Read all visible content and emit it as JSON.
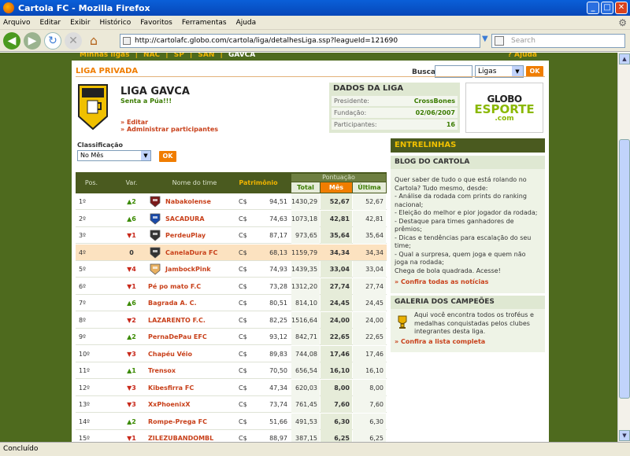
{
  "window": {
    "title": "Cartola FC - Mozilla Firefox"
  },
  "menu": [
    "Arquivo",
    "Editar",
    "Exibir",
    "Histórico",
    "Favoritos",
    "Ferramentas",
    "Ajuda"
  ],
  "browser": {
    "url": "http://cartolafc.globo.com/cartola/liga/detalhesLiga.ssp?leagueId=121690",
    "search_placeholder": "Search",
    "status": "Concluído"
  },
  "top_links": [
    "Minhas ligas",
    "|",
    "NAC",
    "|",
    "SP",
    "|",
    "SAN",
    "|",
    "GAVCA"
  ],
  "help": "? Ajuda",
  "section_title": "LIGA PRIVADA",
  "search": {
    "label": "Busca",
    "select": "Ligas",
    "ok": "OK"
  },
  "liga": {
    "name": "LIGA GAVCA",
    "subtitle": "Senta a Púa!!!",
    "edit_link": "» Editar",
    "admin_link": "» Administrar participantes"
  },
  "dados": {
    "title": "DADOS DA LIGA",
    "rows": [
      {
        "label": "Presidente:",
        "value": "CrossBones"
      },
      {
        "label": "Fundação:",
        "value": "02/06/2007"
      },
      {
        "label": "Participantes:",
        "value": "16"
      }
    ]
  },
  "globo": {
    "line1": "GLOBO",
    "line2": "ESPORTE",
    "line3": ".com"
  },
  "classificacao": {
    "label": "Classificação",
    "selected": "No Mês",
    "ok": "OK"
  },
  "table": {
    "headers": {
      "pos": "Pos.",
      "var": "Var.",
      "team": "Nome do time",
      "pat": "Patrimônio",
      "pont": "Pontuação",
      "total": "Total",
      "mes": "Mês",
      "ult": "Última"
    },
    "rows": [
      {
        "pos": "1º",
        "var": "▲2",
        "dir": "up",
        "team": "Nabakolense",
        "cur": "C$",
        "pat": "94,51",
        "total": "1430,29",
        "mes": "52,67",
        "ult": "52,67",
        "icon": "#7a1a1a"
      },
      {
        "pos": "2º",
        "var": "▲6",
        "dir": "up",
        "team": "SACADURA",
        "cur": "C$",
        "pat": "74,63",
        "total": "1073,18",
        "mes": "42,81",
        "ult": "42,81",
        "icon": "#1a4aa8"
      },
      {
        "pos": "3º",
        "var": "▼1",
        "dir": "down",
        "team": "PerdeuPlay",
        "cur": "C$",
        "pat": "87,17",
        "total": "973,65",
        "mes": "35,64",
        "ult": "35,64",
        "icon": "#333333"
      },
      {
        "pos": "4º",
        "var": "0",
        "dir": "eq",
        "team": "CanelaDura FC",
        "cur": "C$",
        "pat": "68,13",
        "total": "1159,79",
        "mes": "34,34",
        "ult": "34,34",
        "icon": "#333333"
      },
      {
        "pos": "5º",
        "var": "▼4",
        "dir": "down",
        "team": "JambockPink",
        "cur": "C$",
        "pat": "74,93",
        "total": "1439,35",
        "mes": "33,04",
        "ult": "33,04",
        "icon": "#e8b060"
      },
      {
        "pos": "6º",
        "var": "▼1",
        "dir": "down",
        "team": "Pé po mato F.C",
        "cur": "C$",
        "pat": "73,28",
        "total": "1312,20",
        "mes": "27,74",
        "ult": "27,74",
        "icon": ""
      },
      {
        "pos": "7º",
        "var": "▲6",
        "dir": "up",
        "team": "Bagrada A. C.",
        "cur": "C$",
        "pat": "80,51",
        "total": "814,10",
        "mes": "24,45",
        "ult": "24,45",
        "icon": ""
      },
      {
        "pos": "8º",
        "var": "▼2",
        "dir": "down",
        "team": "LAZARENTO F.C.",
        "cur": "C$",
        "pat": "82,25",
        "total": "1516,64",
        "mes": "24,00",
        "ult": "24,00",
        "icon": ""
      },
      {
        "pos": "9º",
        "var": "▲2",
        "dir": "up",
        "team": "PernaDePau EFC",
        "cur": "C$",
        "pat": "93,12",
        "total": "842,71",
        "mes": "22,65",
        "ult": "22,65",
        "icon": ""
      },
      {
        "pos": "10º",
        "var": "▼3",
        "dir": "down",
        "team": "Chapéu Véio",
        "cur": "C$",
        "pat": "89,83",
        "total": "744,08",
        "mes": "17,46",
        "ult": "17,46",
        "icon": ""
      },
      {
        "pos": "11º",
        "var": "▲1",
        "dir": "up",
        "team": "Trensox",
        "cur": "C$",
        "pat": "70,50",
        "total": "656,54",
        "mes": "16,10",
        "ult": "16,10",
        "icon": ""
      },
      {
        "pos": "12º",
        "var": "▼3",
        "dir": "down",
        "team": "Kibesfirra FC",
        "cur": "C$",
        "pat": "47,34",
        "total": "620,03",
        "mes": "8,00",
        "ult": "8,00",
        "icon": ""
      },
      {
        "pos": "13º",
        "var": "▼3",
        "dir": "down",
        "team": "XxPhoenixX",
        "cur": "C$",
        "pat": "73,74",
        "total": "761,45",
        "mes": "7,60",
        "ult": "7,60",
        "icon": ""
      },
      {
        "pos": "14º",
        "var": "▲2",
        "dir": "up",
        "team": "Rompe-Prega FC",
        "cur": "C$",
        "pat": "51,66",
        "total": "491,53",
        "mes": "6,30",
        "ult": "6,30",
        "icon": ""
      },
      {
        "pos": "15º",
        "var": "▼1",
        "dir": "down",
        "team": "ZILEZUBANDOMBL",
        "cur": "C$",
        "pat": "88,97",
        "total": "387,15",
        "mes": "6,25",
        "ult": "6,25",
        "icon": ""
      }
    ]
  },
  "sidebar": {
    "entrelinhas": "ENTRELINHAS",
    "blog_title": "BLOG DO CARTOLA",
    "blog_text": "Quer saber de tudo o que está rolando no Cartola? Tudo mesmo, desde:\n- Análise da rodada com prints do ranking nacional;\n- Eleição do melhor e pior jogador da rodada;\n- Destaque para times ganhadores de prêmios;\n- Dicas e tendências para escalação do seu time;\n- Qual a surpresa, quem joga e quem não joga na rodada;\nChega de bola quadrada. Acesse!",
    "blog_link": "» Confira todas as notícias",
    "galeria_title": "GALERIA DOS CAMPEÕES",
    "galeria_text": "Aqui você encontra todos os troféus e medalhas conquistadas pelos clubes integrantes desta liga.",
    "galeria_link": "» Confira a lista completa"
  }
}
